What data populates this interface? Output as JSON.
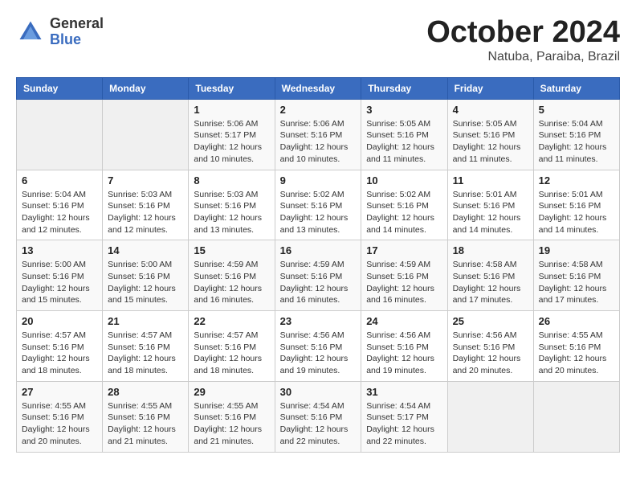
{
  "logo": {
    "general": "General",
    "blue": "Blue"
  },
  "title": "October 2024",
  "location": "Natuba, Paraiba, Brazil",
  "weekdays": [
    "Sunday",
    "Monday",
    "Tuesday",
    "Wednesday",
    "Thursday",
    "Friday",
    "Saturday"
  ],
  "weeks": [
    [
      {
        "day": "",
        "info": ""
      },
      {
        "day": "",
        "info": ""
      },
      {
        "day": "1",
        "info": "Sunrise: 5:06 AM\nSunset: 5:17 PM\nDaylight: 12 hours\nand 10 minutes."
      },
      {
        "day": "2",
        "info": "Sunrise: 5:06 AM\nSunset: 5:16 PM\nDaylight: 12 hours\nand 10 minutes."
      },
      {
        "day": "3",
        "info": "Sunrise: 5:05 AM\nSunset: 5:16 PM\nDaylight: 12 hours\nand 11 minutes."
      },
      {
        "day": "4",
        "info": "Sunrise: 5:05 AM\nSunset: 5:16 PM\nDaylight: 12 hours\nand 11 minutes."
      },
      {
        "day": "5",
        "info": "Sunrise: 5:04 AM\nSunset: 5:16 PM\nDaylight: 12 hours\nand 11 minutes."
      }
    ],
    [
      {
        "day": "6",
        "info": "Sunrise: 5:04 AM\nSunset: 5:16 PM\nDaylight: 12 hours\nand 12 minutes."
      },
      {
        "day": "7",
        "info": "Sunrise: 5:03 AM\nSunset: 5:16 PM\nDaylight: 12 hours\nand 12 minutes."
      },
      {
        "day": "8",
        "info": "Sunrise: 5:03 AM\nSunset: 5:16 PM\nDaylight: 12 hours\nand 13 minutes."
      },
      {
        "day": "9",
        "info": "Sunrise: 5:02 AM\nSunset: 5:16 PM\nDaylight: 12 hours\nand 13 minutes."
      },
      {
        "day": "10",
        "info": "Sunrise: 5:02 AM\nSunset: 5:16 PM\nDaylight: 12 hours\nand 14 minutes."
      },
      {
        "day": "11",
        "info": "Sunrise: 5:01 AM\nSunset: 5:16 PM\nDaylight: 12 hours\nand 14 minutes."
      },
      {
        "day": "12",
        "info": "Sunrise: 5:01 AM\nSunset: 5:16 PM\nDaylight: 12 hours\nand 14 minutes."
      }
    ],
    [
      {
        "day": "13",
        "info": "Sunrise: 5:00 AM\nSunset: 5:16 PM\nDaylight: 12 hours\nand 15 minutes."
      },
      {
        "day": "14",
        "info": "Sunrise: 5:00 AM\nSunset: 5:16 PM\nDaylight: 12 hours\nand 15 minutes."
      },
      {
        "day": "15",
        "info": "Sunrise: 4:59 AM\nSunset: 5:16 PM\nDaylight: 12 hours\nand 16 minutes."
      },
      {
        "day": "16",
        "info": "Sunrise: 4:59 AM\nSunset: 5:16 PM\nDaylight: 12 hours\nand 16 minutes."
      },
      {
        "day": "17",
        "info": "Sunrise: 4:59 AM\nSunset: 5:16 PM\nDaylight: 12 hours\nand 16 minutes."
      },
      {
        "day": "18",
        "info": "Sunrise: 4:58 AM\nSunset: 5:16 PM\nDaylight: 12 hours\nand 17 minutes."
      },
      {
        "day": "19",
        "info": "Sunrise: 4:58 AM\nSunset: 5:16 PM\nDaylight: 12 hours\nand 17 minutes."
      }
    ],
    [
      {
        "day": "20",
        "info": "Sunrise: 4:57 AM\nSunset: 5:16 PM\nDaylight: 12 hours\nand 18 minutes."
      },
      {
        "day": "21",
        "info": "Sunrise: 4:57 AM\nSunset: 5:16 PM\nDaylight: 12 hours\nand 18 minutes."
      },
      {
        "day": "22",
        "info": "Sunrise: 4:57 AM\nSunset: 5:16 PM\nDaylight: 12 hours\nand 18 minutes."
      },
      {
        "day": "23",
        "info": "Sunrise: 4:56 AM\nSunset: 5:16 PM\nDaylight: 12 hours\nand 19 minutes."
      },
      {
        "day": "24",
        "info": "Sunrise: 4:56 AM\nSunset: 5:16 PM\nDaylight: 12 hours\nand 19 minutes."
      },
      {
        "day": "25",
        "info": "Sunrise: 4:56 AM\nSunset: 5:16 PM\nDaylight: 12 hours\nand 20 minutes."
      },
      {
        "day": "26",
        "info": "Sunrise: 4:55 AM\nSunset: 5:16 PM\nDaylight: 12 hours\nand 20 minutes."
      }
    ],
    [
      {
        "day": "27",
        "info": "Sunrise: 4:55 AM\nSunset: 5:16 PM\nDaylight: 12 hours\nand 20 minutes."
      },
      {
        "day": "28",
        "info": "Sunrise: 4:55 AM\nSunset: 5:16 PM\nDaylight: 12 hours\nand 21 minutes."
      },
      {
        "day": "29",
        "info": "Sunrise: 4:55 AM\nSunset: 5:16 PM\nDaylight: 12 hours\nand 21 minutes."
      },
      {
        "day": "30",
        "info": "Sunrise: 4:54 AM\nSunset: 5:16 PM\nDaylight: 12 hours\nand 22 minutes."
      },
      {
        "day": "31",
        "info": "Sunrise: 4:54 AM\nSunset: 5:17 PM\nDaylight: 12 hours\nand 22 minutes."
      },
      {
        "day": "",
        "info": ""
      },
      {
        "day": "",
        "info": ""
      }
    ]
  ]
}
